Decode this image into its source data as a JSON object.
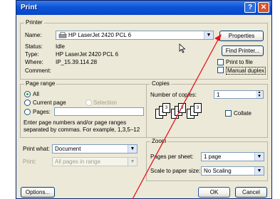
{
  "dialog": {
    "title": "Print",
    "help_glyph": "?",
    "close_glyph": "✕"
  },
  "printer": {
    "group_label": "Printer",
    "name_label": "Name:",
    "name_value": "HP LaserJet 2420 PCL 6",
    "properties_button": "Properties",
    "status_label": "Status:",
    "status_value": "Idle",
    "type_label": "Type:",
    "type_value": "HP LaserJet 2420 PCL 6",
    "where_label": "Where:",
    "where_value": "IP_15.39.114.28",
    "comment_label": "Comment:",
    "comment_value": "",
    "find_printer_button": "Find Printer...",
    "print_to_file_label": "Print to file",
    "manual_duplex_label": "Manual duplex"
  },
  "page_range": {
    "group_label": "Page range",
    "all_label": "All",
    "current_page_label": "Current page",
    "selection_label": "Selection",
    "pages_label": "Pages:",
    "pages_value": "",
    "hint_line1": "Enter page numbers and/or page ranges",
    "hint_line2": "separated by commas.  For example, 1,3,5–12"
  },
  "copies": {
    "group_label": "Copies",
    "number_label": "Number of copies:",
    "number_value": "1",
    "collate_label": "Collate"
  },
  "print_what": {
    "label": "Print what:",
    "value": "Document"
  },
  "print": {
    "label": "Print:",
    "value": "All pages in range"
  },
  "zoom": {
    "group_label": "Zoom",
    "pages_per_sheet_label": "Pages per sheet:",
    "pages_per_sheet_value": "1 page",
    "scale_label": "Scale to paper size:",
    "scale_value": "No Scaling"
  },
  "footer": {
    "options_button": "Options...",
    "ok_button": "OK",
    "cancel_button": "Cancel"
  },
  "annotation": {
    "arrow_color": "#e8131b"
  }
}
